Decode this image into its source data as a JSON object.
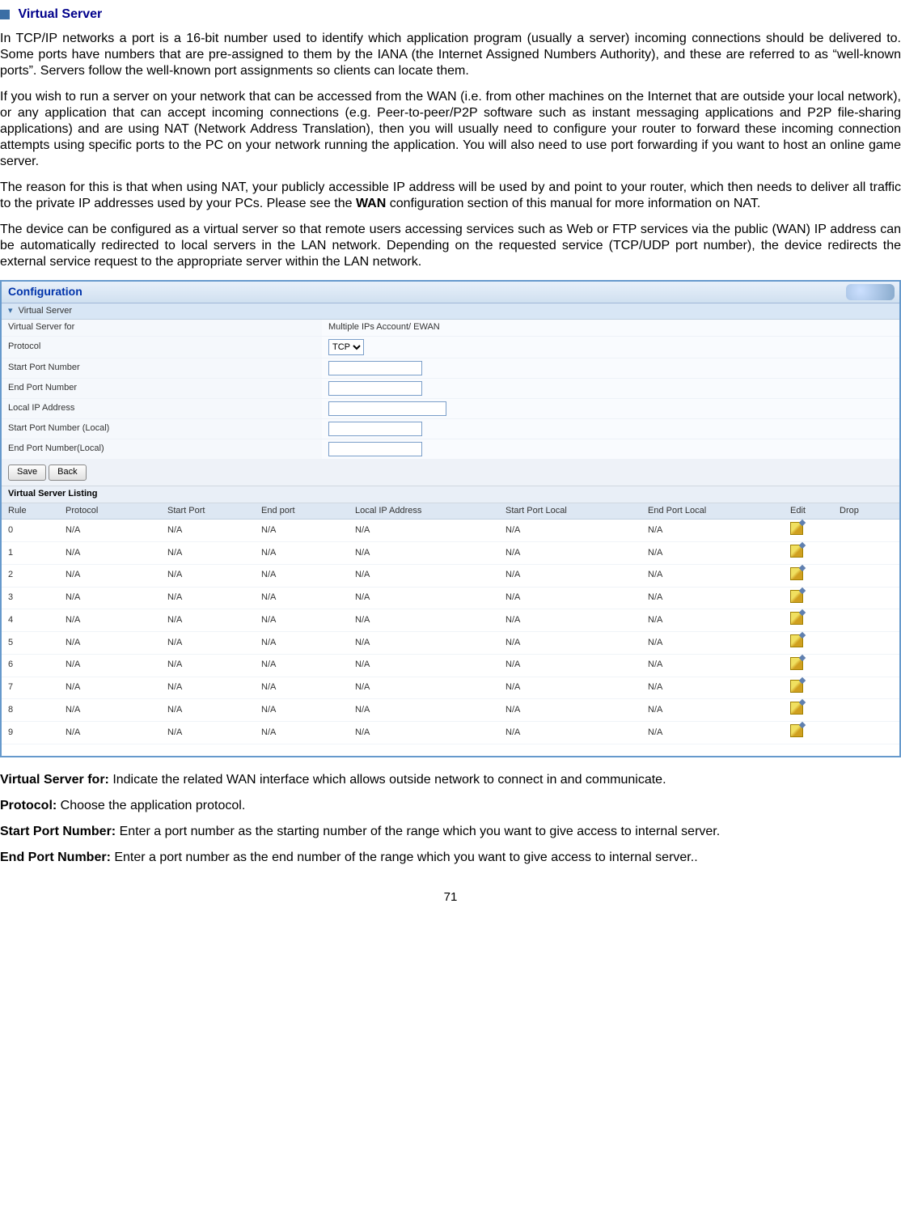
{
  "title": {
    "text": "Virtual Server"
  },
  "paras": {
    "p1": "In TCP/IP networks a port is a 16-bit number used to identify which application program (usually a server) incoming connections should be delivered to. Some ports have numbers that are pre-assigned to them by the IANA (the Internet Assigned Numbers Authority), and these are referred to as “well-known ports”. Servers follow the well-known port assignments so clients can locate them.",
    "p2": "If you wish to run a server on your network that can be accessed from the WAN (i.e. from other machines on the Internet that are outside your local network), or any application that can accept incoming connections (e.g. Peer-to-peer/P2P software such as instant messaging applications and P2P file-sharing applications) and are using NAT (Network Address Translation), then you will usually need to configure your router to forward these incoming connection attempts using specific ports to the PC on your network running the application. You will also need to use port forwarding if you want to host an online game server.",
    "p3a": "The reason for this is that when using NAT, your publicly accessible IP address will be used by and point to your router, which then needs to deliver all traffic to the private IP addresses used by your PCs. Please see the ",
    "p3b": "WAN",
    "p3c": " configuration section of this manual for more information on NAT.",
    "p4": "The device can be configured as a virtual server so that remote users accessing services such as Web or FTP services via the public (WAN) IP address can be automatically redirected to local servers in the LAN network. Depending on the requested service (TCP/UDP port number), the device redirects the external service request to the appropriate server within the LAN network."
  },
  "screenshot": {
    "configHeader": "Configuration",
    "sectionTitle": "Virtual Server",
    "fields": {
      "virtualServerFor": {
        "label": "Virtual Server for",
        "value": "Multiple IPs Account/ EWAN"
      },
      "protocol": {
        "label": "Protocol",
        "selected": "TCP"
      },
      "startPort": {
        "label": "Start Port Number",
        "value": ""
      },
      "endPort": {
        "label": "End Port Number",
        "value": ""
      },
      "localIp": {
        "label": "Local IP Address",
        "value": ""
      },
      "startPortLocal": {
        "label": "Start Port Number (Local)",
        "value": ""
      },
      "endPortLocal": {
        "label": "End Port Number(Local)",
        "value": ""
      }
    },
    "buttons": {
      "save": "Save",
      "back": "Back"
    },
    "listingTitle": "Virtual Server Listing",
    "listingHeaders": {
      "rule": "Rule",
      "protocol": "Protocol",
      "startPort": "Start Port",
      "endPort": "End port",
      "localIp": "Local IP Address",
      "startPortLocal": "Start Port Local",
      "endPortLocal": "End Port Local",
      "edit": "Edit",
      "drop": "Drop"
    },
    "listingRows": [
      {
        "rule": "0",
        "protocol": "N/A",
        "startPort": "N/A",
        "endPort": "N/A",
        "localIp": "N/A",
        "startPortLocal": "N/A",
        "endPortLocal": "N/A"
      },
      {
        "rule": "1",
        "protocol": "N/A",
        "startPort": "N/A",
        "endPort": "N/A",
        "localIp": "N/A",
        "startPortLocal": "N/A",
        "endPortLocal": "N/A"
      },
      {
        "rule": "2",
        "protocol": "N/A",
        "startPort": "N/A",
        "endPort": "N/A",
        "localIp": "N/A",
        "startPortLocal": "N/A",
        "endPortLocal": "N/A"
      },
      {
        "rule": "3",
        "protocol": "N/A",
        "startPort": "N/A",
        "endPort": "N/A",
        "localIp": "N/A",
        "startPortLocal": "N/A",
        "endPortLocal": "N/A"
      },
      {
        "rule": "4",
        "protocol": "N/A",
        "startPort": "N/A",
        "endPort": "N/A",
        "localIp": "N/A",
        "startPortLocal": "N/A",
        "endPortLocal": "N/A"
      },
      {
        "rule": "5",
        "protocol": "N/A",
        "startPort": "N/A",
        "endPort": "N/A",
        "localIp": "N/A",
        "startPortLocal": "N/A",
        "endPortLocal": "N/A"
      },
      {
        "rule": "6",
        "protocol": "N/A",
        "startPort": "N/A",
        "endPort": "N/A",
        "localIp": "N/A",
        "startPortLocal": "N/A",
        "endPortLocal": "N/A"
      },
      {
        "rule": "7",
        "protocol": "N/A",
        "startPort": "N/A",
        "endPort": "N/A",
        "localIp": "N/A",
        "startPortLocal": "N/A",
        "endPortLocal": "N/A"
      },
      {
        "rule": "8",
        "protocol": "N/A",
        "startPort": "N/A",
        "endPort": "N/A",
        "localIp": "N/A",
        "startPortLocal": "N/A",
        "endPortLocal": "N/A"
      },
      {
        "rule": "9",
        "protocol": "N/A",
        "startPort": "N/A",
        "endPort": "N/A",
        "localIp": "N/A",
        "startPortLocal": "N/A",
        "endPortLocal": "N/A"
      }
    ]
  },
  "defs": {
    "d1": {
      "label": "Virtual Server for: ",
      "text": "Indicate the related WAN interface which allows outside network to connect in and communicate."
    },
    "d2": {
      "label": "Protocol: ",
      "text": "Choose the application protocol."
    },
    "d3": {
      "label": "Start Port Number: ",
      "text": "Enter a port number as the starting number of the range which you want to give access to internal server."
    },
    "d4": {
      "label": "End Port Number: ",
      "text": "Enter a port number as the end number of the range which you want to give access to internal server.."
    }
  },
  "pageNumber": "71"
}
